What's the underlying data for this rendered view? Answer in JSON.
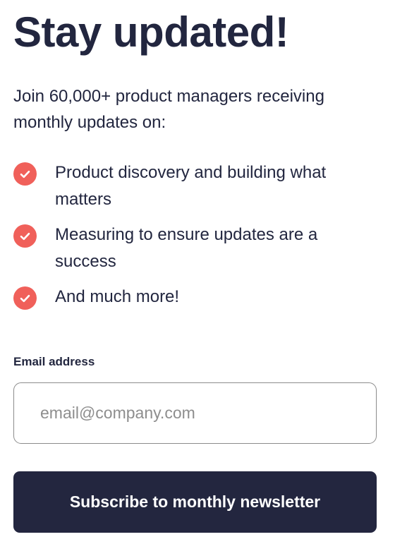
{
  "heading": "Stay updated!",
  "intro": "Join 60,000+ product managers receiving monthly updates on:",
  "benefits": [
    {
      "icon": "check-circle-icon",
      "text": "Product discovery and building what matters"
    },
    {
      "icon": "check-circle-icon",
      "text": "Measuring to ensure updates are a success"
    },
    {
      "icon": "check-circle-icon",
      "text": "And much more!"
    }
  ],
  "form": {
    "email_label": "Email address",
    "email_placeholder": "email@company.com",
    "email_value": "",
    "submit_label": "Subscribe to monthly newsletter"
  },
  "colors": {
    "text": "#22263f",
    "accent": "#f0605a",
    "button_background": "#23263f",
    "input_border": "#8c8c8c",
    "placeholder": "#8e8e8e"
  }
}
